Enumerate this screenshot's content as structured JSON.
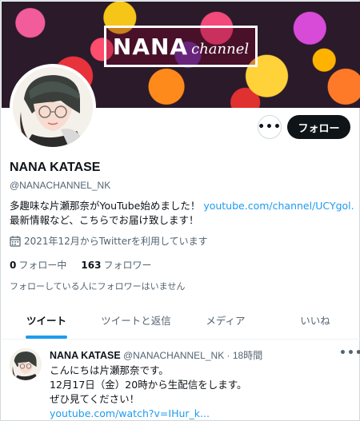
{
  "banner": {
    "logo_main": "NANA",
    "logo_script": "channel"
  },
  "profile": {
    "name": "NANA KATASE",
    "handle": "@NANACHANNEL_NK",
    "bio_line1": "多趣味な片瀬那奈がYouTube始めました！ ",
    "bio_link": "youtube.com/channel/UCYgol...",
    "bio_line2": "最新情報など、こちらでお届け致します！",
    "joined": "2021年12月からTwitterを利用しています",
    "following_count": "0",
    "following_label": "フォロー中",
    "followers_count": "163",
    "followers_label": "フォロワー",
    "no_followers_note": "フォローしている人にフォロワーはいません"
  },
  "actions": {
    "more": "•••",
    "follow_label": "フォロー"
  },
  "tabs": [
    {
      "label": "ツイート",
      "active": true
    },
    {
      "label": "ツイートと返信",
      "active": false
    },
    {
      "label": "メディア",
      "active": false
    },
    {
      "label": "いいね",
      "active": false
    }
  ],
  "tweet": {
    "name": "NANA KATASE",
    "meta": " @NANACHANNEL_NK · 18時間",
    "more": "•••",
    "line1": "こんにちは片瀬那奈です。",
    "line2": "12月17日（金）20時から生配信をします。",
    "line3": "ぜひ見てください！",
    "link": "youtube.com/watch?v=IHur_k..."
  },
  "colors": {
    "accent": "#1d9bf0",
    "text": "#0f1419",
    "muted": "#536471",
    "follow_bg": "#0f1419"
  },
  "icons": {
    "calendar": "calendar-icon",
    "more": "more-horizontal-icon"
  }
}
